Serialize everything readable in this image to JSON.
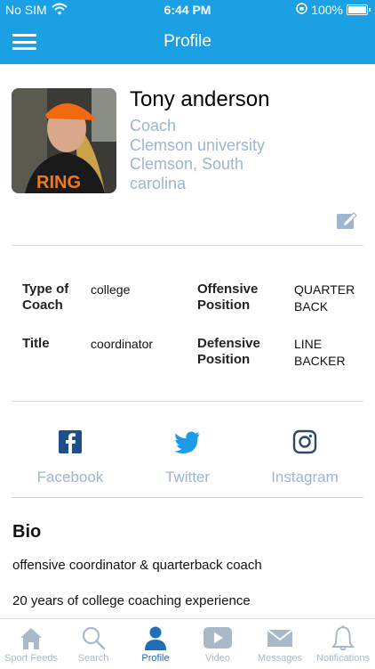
{
  "status_bar": {
    "carrier": "No SIM",
    "time": "6:44 PM",
    "battery": "100%",
    "battery_level": 1.0
  },
  "header": {
    "title": "Profile"
  },
  "profile": {
    "name": "Tony anderson",
    "role": "Coach",
    "organization": "Clemson university",
    "location_line1": "Clemson, South",
    "location_line2": "carolina"
  },
  "details": {
    "type_label": "Type of Coach",
    "type_value": "college",
    "offensive_label": "Offensive Position",
    "offensive_value": "QUARTER BACK",
    "title_label": "Title",
    "title_value": "coordinator",
    "defensive_label": "Defensive Position",
    "defensive_value": "LINE BACKER"
  },
  "social": {
    "facebook": "Facebook",
    "twitter": "Twitter",
    "instagram": "Instagram"
  },
  "bio": {
    "heading": "Bio",
    "line1": "offensive coordinator & quarterback coach",
    "line2": "20 years of college coaching experience"
  },
  "tabs": [
    {
      "label": "Sport Feeds",
      "icon": "home-icon"
    },
    {
      "label": "Search",
      "icon": "search-icon"
    },
    {
      "label": "Profile",
      "icon": "person-icon"
    },
    {
      "label": "Video",
      "icon": "video-icon"
    },
    {
      "label": "Messages",
      "icon": "mail-icon"
    },
    {
      "label": "Notifications",
      "icon": "bell-icon"
    }
  ],
  "colors": {
    "primary": "#1aa0e3",
    "accent_text": "#9cb5d2",
    "tab_active": "#1d6fb8",
    "tab_inactive": "#a9b9ca"
  }
}
